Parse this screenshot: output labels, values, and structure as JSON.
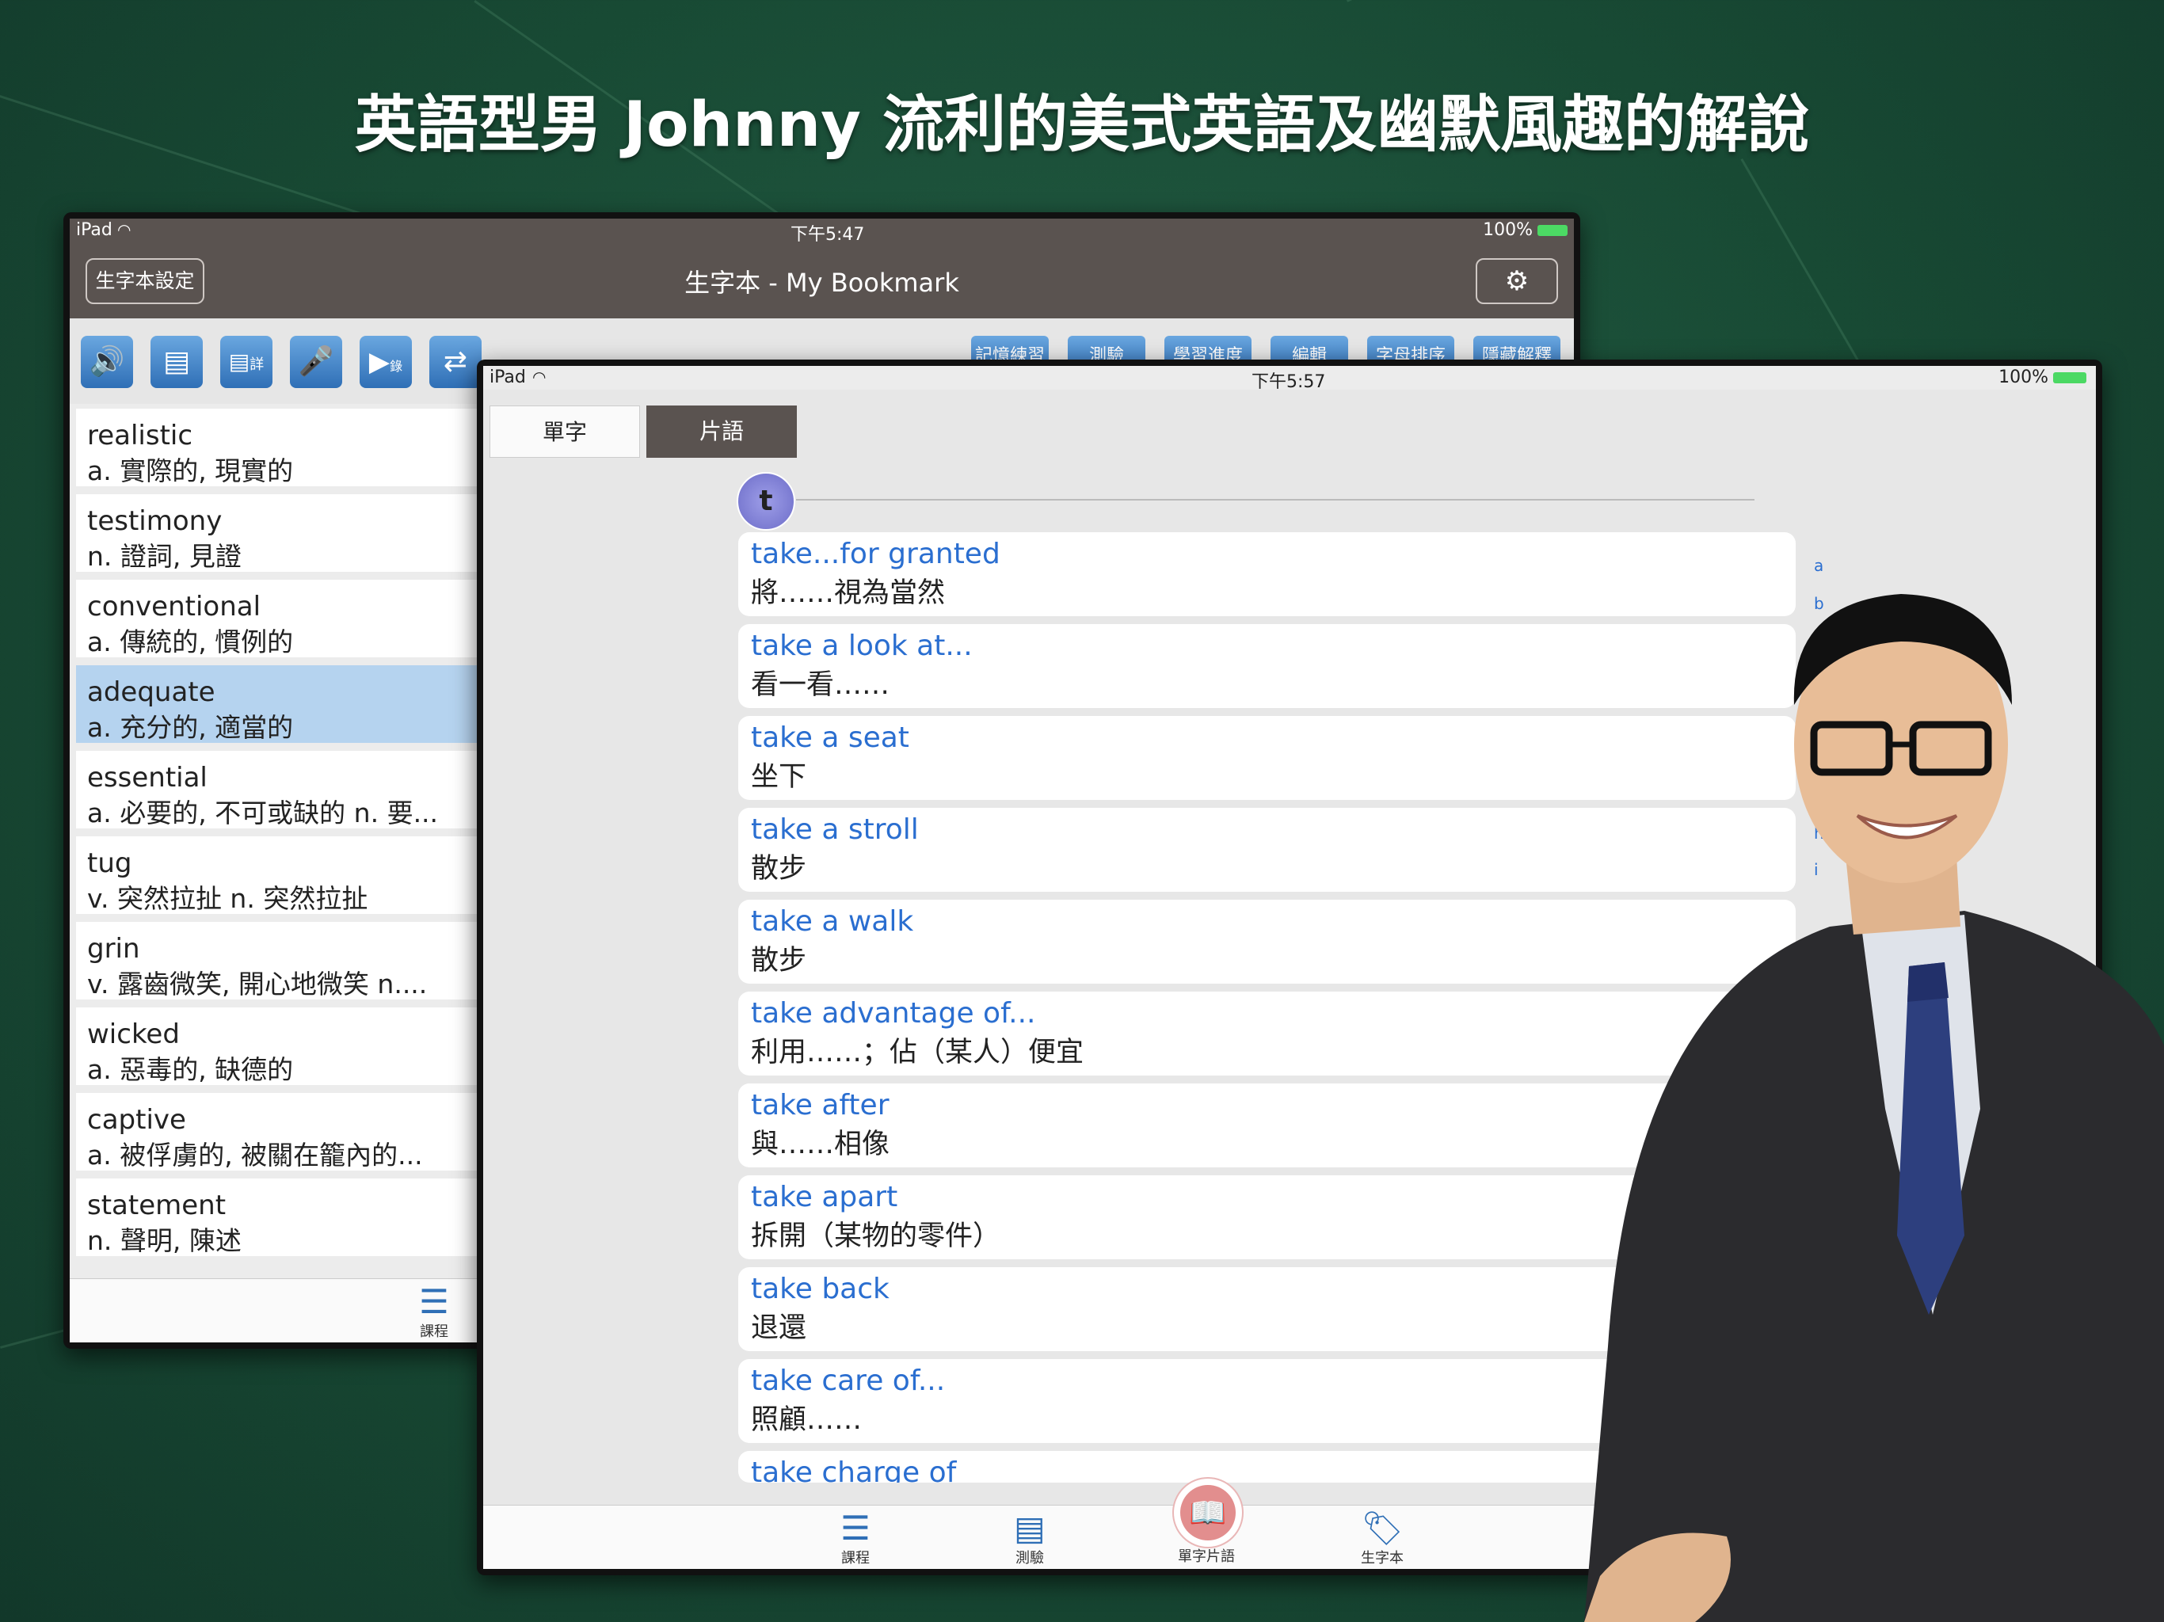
{
  "headline": "英語型男 Johnny 流利的美式英語及幽默風趣的解說",
  "back_ipad": {
    "status": {
      "device": "iPad",
      "time": "下午5:47",
      "battery": "100%"
    },
    "nav": {
      "left_button": "生字本設定",
      "title": "生字本 - My Bookmark",
      "right_icon": "gear-icon"
    },
    "toolbar": {
      "icons": [
        "speaker-icon",
        "document-icon",
        "detail-document-icon",
        "microphone-icon",
        "play-record-icon",
        "swap-icon"
      ],
      "detail_icon_label": "詳",
      "play_icon_label": "錄",
      "buttons": [
        "記憶練習",
        "測驗",
        "學習進度",
        "編輯",
        "字母排序",
        "隱藏解釋"
      ]
    },
    "words": [
      {
        "en": "realistic",
        "zh": "a. 實際的, 現實的"
      },
      {
        "en": "testimony",
        "zh": "n. 證詞, 見證"
      },
      {
        "en": "conventional",
        "zh": "a. 傳統的, 慣例的"
      },
      {
        "en": "adequate",
        "zh": "a. 充分的, 適當的"
      },
      {
        "en": "essential",
        "zh": "a. 必要的, 不可或缺的  n. 要..."
      },
      {
        "en": "tug",
        "zh": "v. 突然拉扯  n. 突然拉扯"
      },
      {
        "en": "grin",
        "zh": "v. 露齒微笑, 開心地微笑  n...."
      },
      {
        "en": "wicked",
        "zh": "a. 惡毒的, 缺德的"
      },
      {
        "en": "captive",
        "zh": "a. 被俘虜的, 被關在籠內的..."
      },
      {
        "en": "statement",
        "zh": "n. 聲明, 陳述"
      }
    ],
    "tabbar": {
      "label": "課程",
      "icon": "list-icon"
    }
  },
  "front_ipad": {
    "status": {
      "device": "iPad",
      "time": "下午5:57",
      "battery": "100%"
    },
    "segments": [
      "單字",
      "片語"
    ],
    "section_letter": "t",
    "phrases": [
      {
        "en": "take...for granted",
        "zh": "將……視為當然"
      },
      {
        "en": "take a look at...",
        "zh": "看一看……"
      },
      {
        "en": "take a seat",
        "zh": "坐下"
      },
      {
        "en": "take a stroll",
        "zh": "散步"
      },
      {
        "en": "take a walk",
        "zh": "散步"
      },
      {
        "en": "take advantage of...",
        "zh": "利用……；佔（某人）便宜"
      },
      {
        "en": "take after",
        "zh": "與……相像"
      },
      {
        "en": "take apart",
        "zh": "拆開（某物的零件）"
      },
      {
        "en": "take back",
        "zh": "退還"
      },
      {
        "en": "take care of...",
        "zh": "照顧……"
      },
      {
        "en": "take charge of",
        "zh": ""
      }
    ],
    "index_letters": [
      "a",
      "b",
      "h",
      "i"
    ],
    "tabbar": [
      {
        "label": "課程",
        "icon": "list-icon"
      },
      {
        "label": "測驗",
        "icon": "document-icon"
      },
      {
        "label": "單字片語",
        "icon": "book-icon"
      },
      {
        "label": "生字本",
        "icon": "tag-icon"
      }
    ]
  },
  "colors": {
    "background": "#1c523b",
    "nav": "#5a5350",
    "accent": "#2a6ed0",
    "selected": "#b5d3ef"
  }
}
